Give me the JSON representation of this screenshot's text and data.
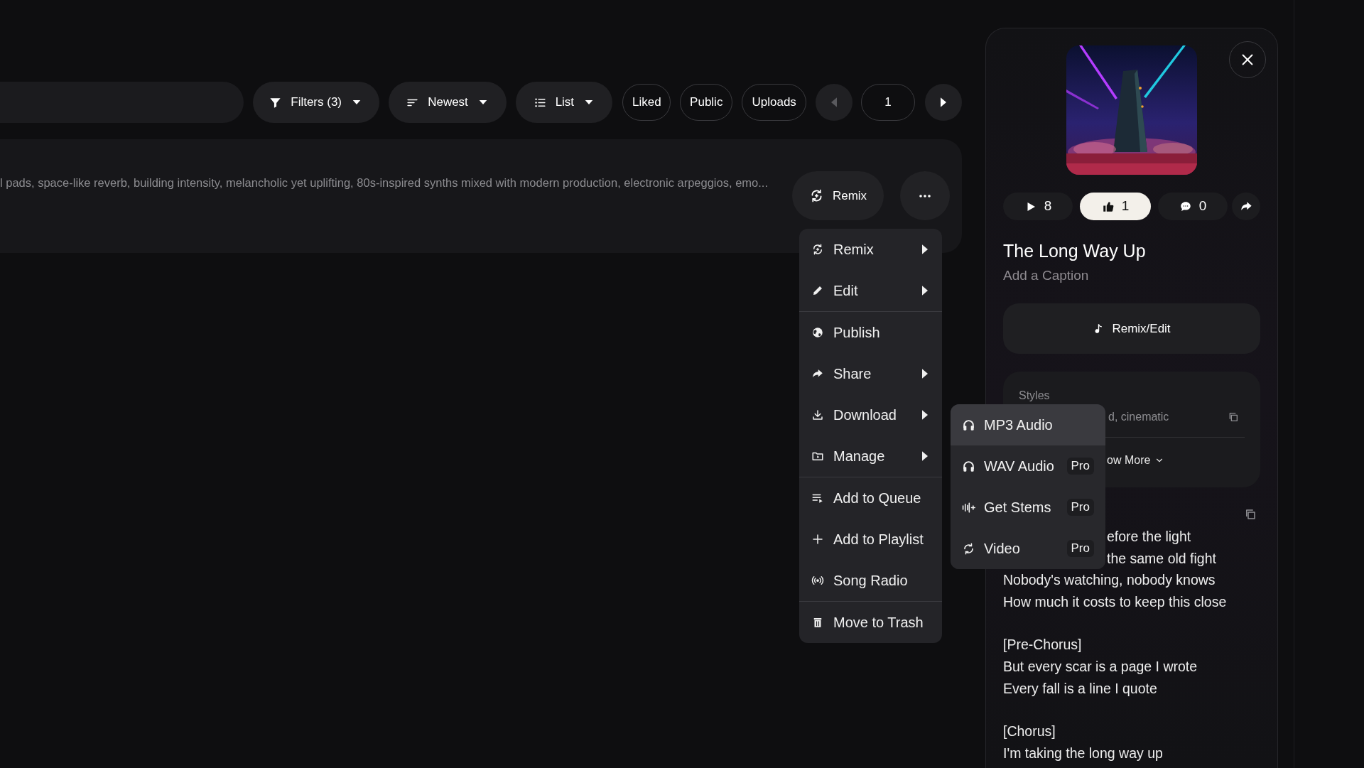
{
  "toolbar": {
    "dropdowns": [
      {
        "kind": "filter",
        "label": "Filters (3)"
      },
      {
        "kind": "sort",
        "label": "Newest"
      },
      {
        "kind": "list",
        "label": "List"
      }
    ],
    "toggles": [
      {
        "label": "Liked",
        "selected": false
      },
      {
        "label": "Public",
        "selected": false
      },
      {
        "label": "Uploads",
        "selected": false
      }
    ],
    "pagination": {
      "previous_disabled": true,
      "page": "1",
      "next_disabled": false
    }
  },
  "song_row": {
    "description": "l pads, space-like reverb, building intensity, melancholic yet uplifting, 80s-inspired synths mixed with modern production, electronic arpeggios, emo...",
    "remix_button": "Remix"
  },
  "menu": {
    "groups": [
      [
        {
          "kind": "remix",
          "label": "Remix",
          "submenu": true
        },
        {
          "kind": "edit",
          "label": "Edit",
          "submenu": true
        }
      ],
      [
        {
          "kind": "publish",
          "label": "Publish",
          "submenu": false
        },
        {
          "kind": "share",
          "label": "Share",
          "submenu": true
        },
        {
          "kind": "download",
          "label": "Download",
          "submenu": true
        },
        {
          "kind": "manage",
          "label": "Manage",
          "submenu": true
        }
      ],
      [
        {
          "kind": "queue",
          "label": "Add to Queue",
          "submenu": false
        },
        {
          "kind": "playlist",
          "label": "Add to Playlist",
          "submenu": false
        },
        {
          "kind": "radio",
          "label": "Song Radio",
          "submenu": false
        }
      ],
      [
        {
          "kind": "trash",
          "label": "Move to Trash",
          "submenu": false
        }
      ]
    ]
  },
  "download_submenu": [
    {
      "kind": "audio",
      "label": "MP3 Audio",
      "highlighted": true
    },
    {
      "kind": "audio",
      "label": "WAV Audio",
      "highlighted": false,
      "badge": "Pro"
    },
    {
      "kind": "stems",
      "label": "Get Stems",
      "highlighted": false,
      "badge": "Pro"
    },
    {
      "kind": "video",
      "label": "Video",
      "highlighted": false,
      "badge": "Pro"
    }
  ],
  "song_panel": {
    "stats": [
      {
        "kind": "plays",
        "value": "8",
        "selected": false
      },
      {
        "kind": "likes",
        "value": "1",
        "selected": true
      },
      {
        "kind": "comments",
        "value": "0",
        "selected": false
      }
    ],
    "title": "The Long Way Up",
    "caption": "Add a Caption",
    "remix_edit_button": "Remix/Edit",
    "styles": {
      "label": "Styles",
      "text": "d, cinematic",
      "show_more": "ow More"
    },
    "lyrics": {
      "partly_covered_lines": [
        "efore the light",
        "the same old fight"
      ],
      "stanzas": [
        [
          "Nobody's watching, nobody knows",
          "How much it costs to keep this close"
        ],
        [
          "[Pre-Chorus]",
          "But every scar is a page I wrote",
          "Every fall is a line I quote"
        ],
        [
          "[Chorus]",
          "I'm taking the long way up"
        ]
      ]
    }
  }
}
